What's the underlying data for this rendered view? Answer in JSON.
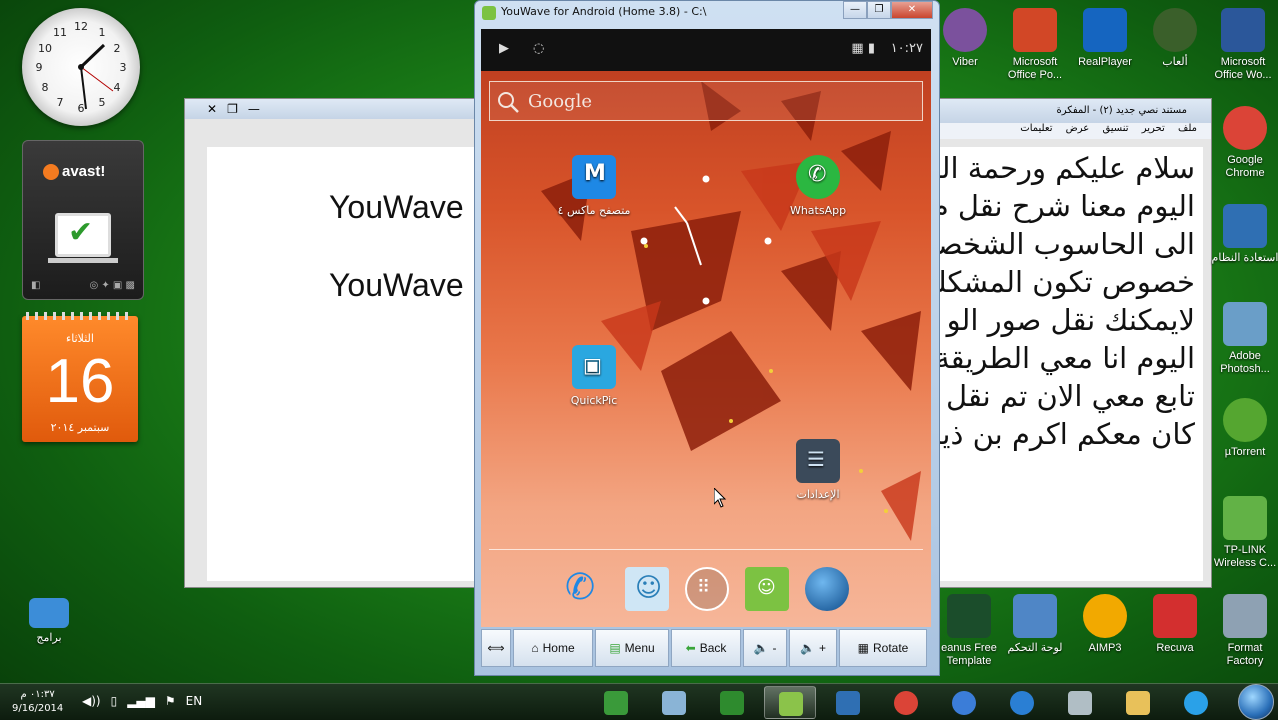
{
  "youwave": {
    "title": "YouWave for Android (Home 3.8) - C:\\",
    "clock": "١٠:٢٧",
    "search_placeholder": "Google",
    "apps": [
      {
        "label": "متصفح ماكس ٤",
        "icon": "maxthon-browser-icon",
        "color": "#1e88e5"
      },
      {
        "label": "WhatsApp",
        "icon": "whatsapp-icon",
        "color": "#2bb741"
      },
      {
        "label": "QuickPic",
        "icon": "quickpic-icon",
        "color": "#2aa7e0"
      },
      {
        "label": "الإعدادات",
        "icon": "settings-icon",
        "color": "#3b4a5a"
      }
    ],
    "dock": [
      "phone-icon",
      "contacts-icon",
      "app-drawer-icon",
      "messaging-icon",
      "browser-globe-icon"
    ],
    "controls": {
      "home": "Home",
      "menu": "Menu",
      "back": "Back",
      "vol_down": "-",
      "vol_up": "+",
      "rotate": "Rotate"
    }
  },
  "word_left": {
    "line1": "YouWave",
    "line2": "YouWave"
  },
  "word_right": {
    "title": "مستند نصي جديد (٢) - المفكرة",
    "menu": [
      "ملف",
      "تحرير",
      "تنسيق",
      "عرض",
      "تعليمات"
    ],
    "lines": [
      "سلام عليكم ورحمة الله",
      "اليوم معنا شرح نقل م",
      "الى الحاسوب الشخصي",
      "خصوص تكون المشكلة",
      "لايمكنك نقل صور الو",
      "اليوم انا معي الطريقة:",
      "تابع معي الان تم نقل ال",
      "كان معكم اكرم بن ذياب"
    ]
  },
  "calendar": {
    "day_name": "الثلاثاء",
    "day": "16",
    "month": "سبتمبر ٢٠١٤"
  },
  "avast": {
    "brand": "avast!"
  },
  "desktop_icons_top": [
    {
      "label": "Viber",
      "color": "#7b519d"
    },
    {
      "label": "Microsoft Office Po...",
      "color": "#d24726"
    },
    {
      "label": "RealPlayer",
      "color": "#1565c0"
    },
    {
      "label": "ألعاب",
      "color": "#3a5f2a"
    },
    {
      "label": "Microsoft Office Wo...",
      "color": "#2b579a"
    }
  ],
  "desktop_icons_right": [
    {
      "label": "Google Chrome",
      "color": "#db4437"
    },
    {
      "label": "استعادة النظام",
      "color": "#2f6fb3"
    },
    {
      "label": "Adobe Photosh...",
      "color": "#6a9ec8"
    },
    {
      "label": "µTorrent",
      "color": "#55a630"
    },
    {
      "label": "TP-LINK Wireless C...",
      "color": "#62b246"
    },
    {
      "label": "Format Factory",
      "color": "#8ea1b3"
    }
  ],
  "desktop_icons_bottom": [
    {
      "label": "eanus Free Template",
      "color": "#1b4d2b"
    },
    {
      "label": "لوحة التحكم",
      "color": "#4f86c6"
    },
    {
      "label": "AIMP3",
      "color": "#f2a900"
    },
    {
      "label": "Recuva",
      "color": "#d32f2f"
    }
  ],
  "desktop_icon_programs": {
    "label": "برامج",
    "color": "#3c8dd8"
  },
  "taskbar": {
    "time": "٠١:٣٧ م",
    "date": "9/16/2014",
    "lang": "EN",
    "buttons": [
      {
        "icon": "camtasia-icon",
        "color": "#3a9a3a"
      },
      {
        "icon": "notepad-icon",
        "color": "#8ab4d6"
      },
      {
        "icon": "camtasia-recorder-icon",
        "color": "#2e8b2e"
      },
      {
        "icon": "android-icon",
        "color": "#8bc34a"
      },
      {
        "icon": "remote-desktop-icon",
        "color": "#2f6fb3"
      },
      {
        "icon": "chrome-icon",
        "color": "#db4437"
      },
      {
        "icon": "network-icon",
        "color": "#3b7dd8"
      },
      {
        "icon": "ccleaner-icon",
        "color": "#2a7fd4"
      },
      {
        "icon": "calculator-icon",
        "color": "#b0bec5"
      },
      {
        "icon": "folder-icon",
        "color": "#e8c15a"
      },
      {
        "icon": "internet-explorer-icon",
        "color": "#2aa1e8"
      }
    ]
  }
}
